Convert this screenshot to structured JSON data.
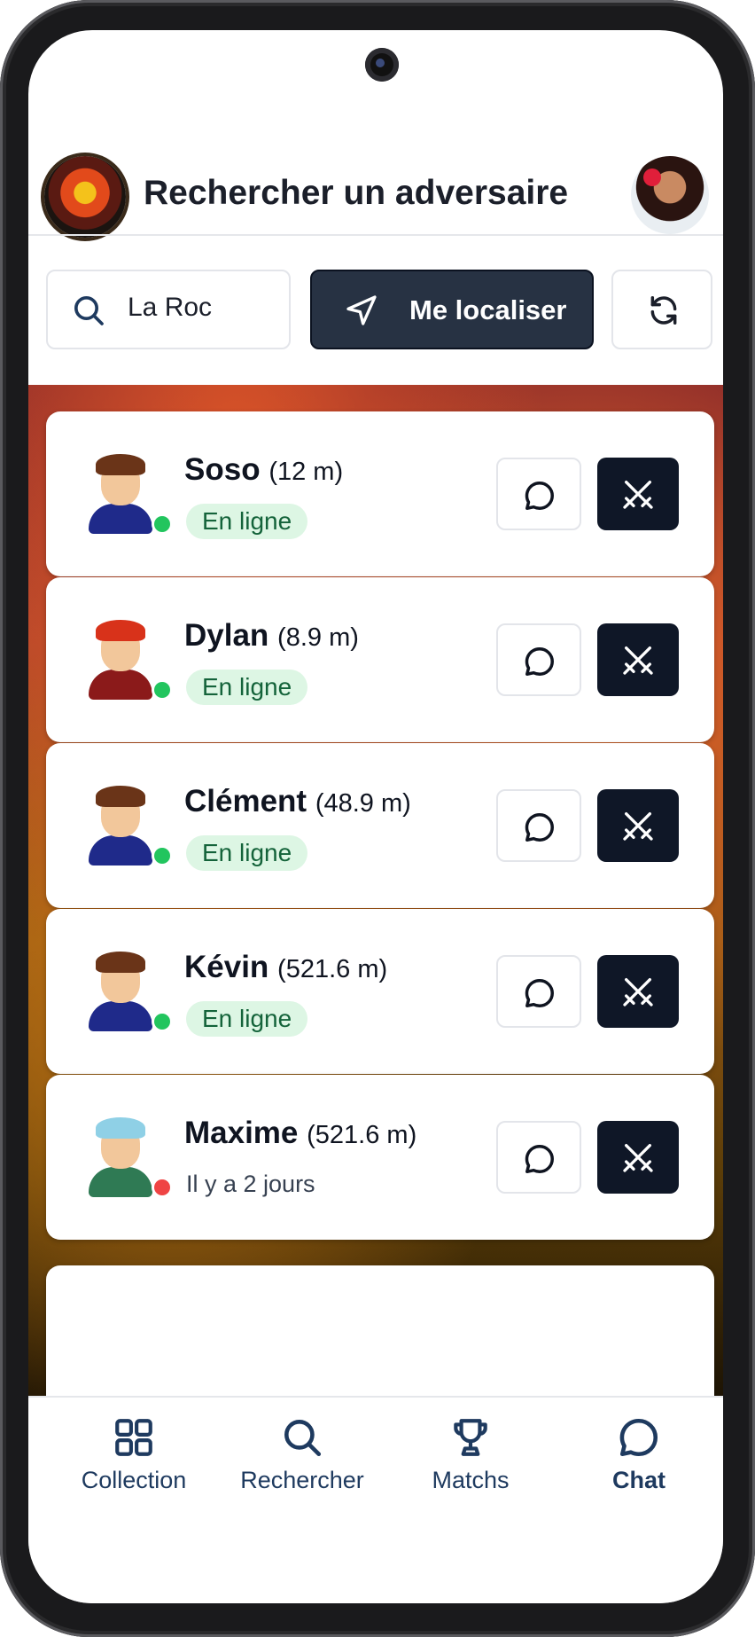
{
  "header": {
    "title": "Rechercher un adversaire"
  },
  "search": {
    "value": "La Roc",
    "locate_label": "Me localiser"
  },
  "players": [
    {
      "name": "Soso",
      "distance": "(12 m)",
      "status": "online",
      "status_label": "En ligne",
      "hair": "#6a3418",
      "body": "#1f2a8a"
    },
    {
      "name": "Dylan",
      "distance": "(8.9 m)",
      "status": "online",
      "status_label": "En ligne",
      "hair": "#d8321a",
      "body": "#8b1a1a"
    },
    {
      "name": "Clément",
      "distance": "(48.9 m)",
      "status": "online",
      "status_label": "En ligne",
      "hair": "#6a3418",
      "body": "#1f2a8a"
    },
    {
      "name": "Kévin",
      "distance": "(521.6 m)",
      "status": "online",
      "status_label": "En ligne",
      "hair": "#6a3418",
      "body": "#1f2a8a"
    },
    {
      "name": "Maxime",
      "distance": "(521.6 m)",
      "status": "offline",
      "status_label": "Il y a 2   jours",
      "hair": "#8fd0e6",
      "body": "#2f7a54"
    }
  ],
  "status_colors": {
    "online": "#22c55e",
    "offline": "#ef4444"
  },
  "nav": [
    {
      "label": "Collection",
      "icon": "grid-icon"
    },
    {
      "label": "Rechercher",
      "icon": "search-icon"
    },
    {
      "label": "Matchs",
      "icon": "trophy-icon"
    },
    {
      "label": "Chat",
      "icon": "chat-icon"
    }
  ]
}
